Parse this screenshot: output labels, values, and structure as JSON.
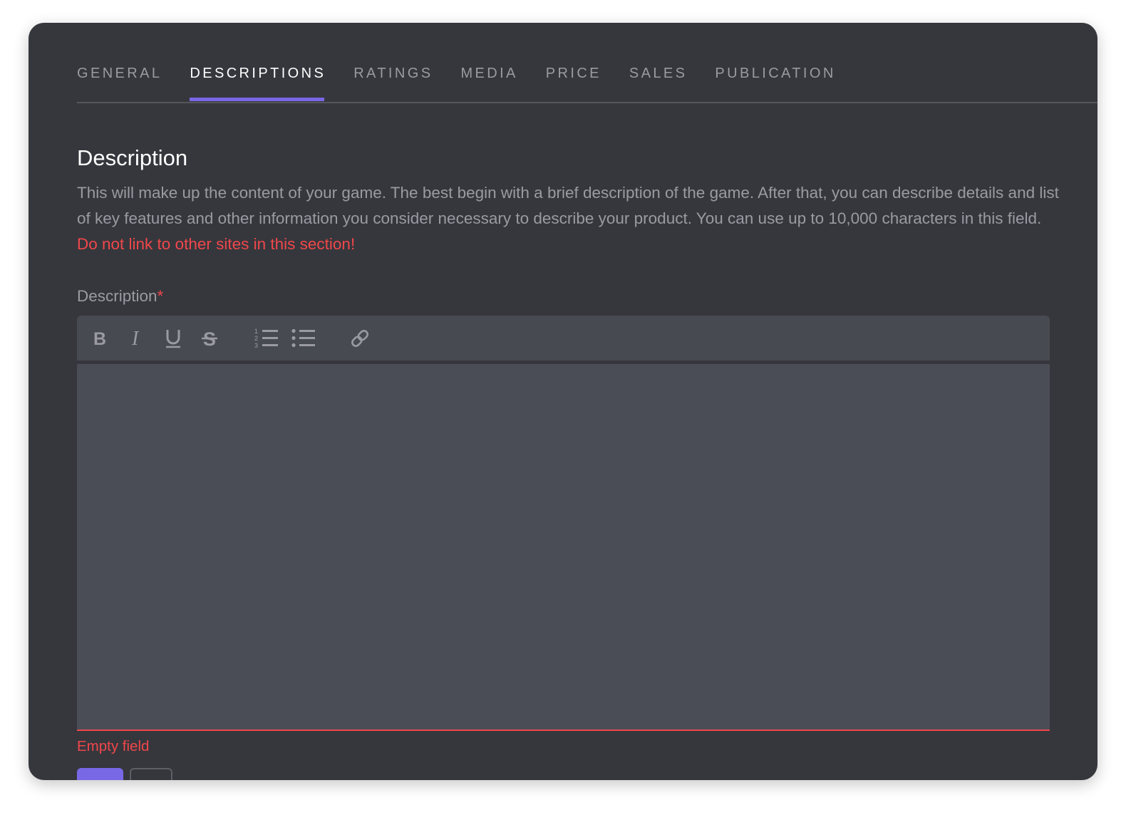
{
  "tabs": {
    "general": "GENERAL",
    "descriptions": "DESCRIPTIONS",
    "ratings": "RATINGS",
    "media": "MEDIA",
    "price": "PRICE",
    "sales": "SALES",
    "publication": "PUBLICATION",
    "active": "DESCRIPTIONS"
  },
  "section": {
    "title": "Description",
    "text": "This will make up the content of your game. The best begin with a brief description of the game. After that, you can describe details and list of key features and other information you consider necessary to describe your product. You can use up to 10,000 characters in this field. ",
    "warning": "Do not link to other sites in this section!"
  },
  "field": {
    "label": "Description",
    "required_marker": "*",
    "value": "",
    "error": "Empty field"
  },
  "toolbar": {
    "icons": [
      "bold-icon",
      "italic-icon",
      "underline-icon",
      "strikethrough-icon",
      "ordered-list-icon",
      "bullet-list-icon",
      "link-icon"
    ]
  },
  "colors": {
    "panel_bg": "#36373d",
    "accent": "#7868e6",
    "error": "#f0474a",
    "muted_text": "#9a9ba2"
  }
}
